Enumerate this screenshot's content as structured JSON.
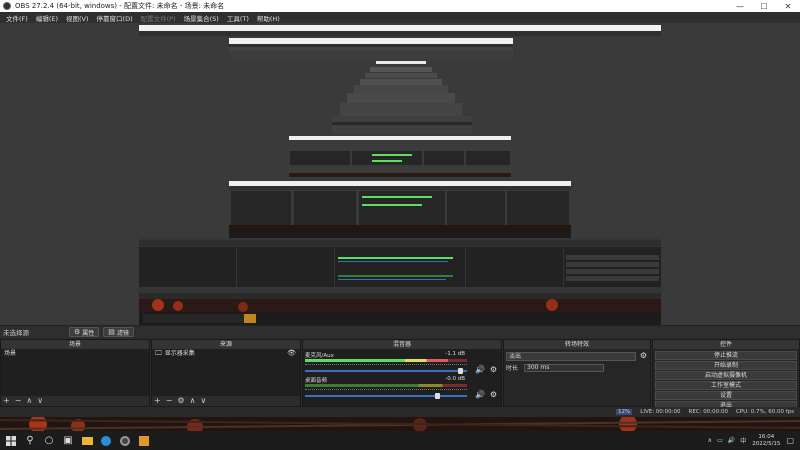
{
  "window": {
    "title": "OBS 27.2.4 (64-bit, windows) - 配置文件: 未命名 - 场景: 未命名",
    "minimize": "—",
    "maximize": "☐",
    "close": "✕"
  },
  "menu": {
    "items": [
      "文件(F)",
      "编辑(E)",
      "视图(V)",
      "停靠窗口(D)",
      "配置文件(P)",
      "场景集合(S)",
      "工具(T)",
      "帮助(H)"
    ]
  },
  "scene_toolbar": {
    "label": "未选择源",
    "properties": "属性",
    "filters": "滤镜"
  },
  "scenes": {
    "title": "场景",
    "items": [
      "场景"
    ]
  },
  "sources": {
    "title": "来源",
    "items": [
      "显示器采集"
    ]
  },
  "mixer": {
    "title": "混音器",
    "channels": [
      {
        "name": "麦克风/Aux",
        "db": "-1.1 dB",
        "level": 0.88,
        "volume": 0.96
      },
      {
        "name": "桌面音频",
        "db": "-0.0 dB",
        "level": 0.0,
        "volume": 0.82
      }
    ]
  },
  "transitions": {
    "title": "转场特效",
    "selected": "淡出",
    "duration_label": "时长",
    "duration_value": "300 ms"
  },
  "controls": {
    "title": "控件",
    "buttons": [
      "停止推流",
      "开始录制",
      "启动虚拟摄像机",
      "工作室模式",
      "设置",
      "退出"
    ]
  },
  "status": {
    "live": "LIVE: 00:00:00",
    "rec": "REC: 00:00:00",
    "cpu": "CPU: 0.7%, 60.00 fps",
    "dropped": "12%"
  },
  "taskbar": {
    "time": "16:04",
    "date": "2022/5/15",
    "lang": "中"
  }
}
